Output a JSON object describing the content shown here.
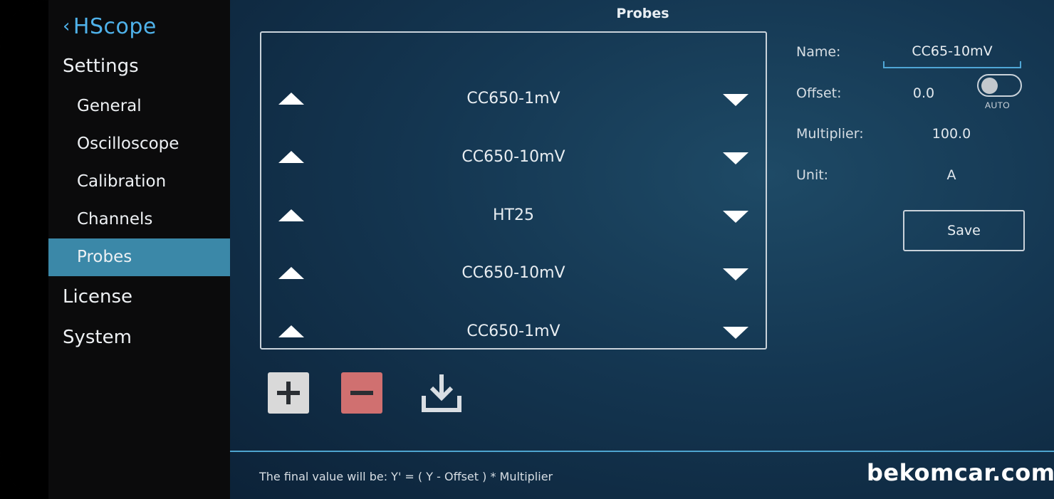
{
  "sidebar": {
    "back_chevron": "‹",
    "app_title": "HScope",
    "settings": "Settings",
    "items": [
      {
        "label": "General"
      },
      {
        "label": "Oscilloscope"
      },
      {
        "label": "Calibration"
      },
      {
        "label": "Channels"
      },
      {
        "label": "Probes"
      }
    ],
    "license": "License",
    "system": "System",
    "active_item": "Probes"
  },
  "main": {
    "title": "Probes",
    "probes": [
      {
        "label": "CC650-1mV"
      },
      {
        "label": "CC650-10mV"
      },
      {
        "label": "HT25"
      },
      {
        "label": "CC650-10mV"
      },
      {
        "label": "CC650-1mV"
      }
    ],
    "actions": {
      "add_icon": "plus-icon",
      "remove_icon": "minus-icon",
      "download_icon": "download-icon"
    },
    "properties": {
      "name_label": "Name:",
      "name_value": "CC65-10mV",
      "offset_label": "Offset:",
      "offset_value": "0.0",
      "auto_label": "AUTO",
      "auto_enabled": false,
      "multiplier_label": "Multiplier:",
      "multiplier_value": "100.0",
      "unit_label": "Unit:",
      "unit_value": "A",
      "save_label": "Save"
    },
    "footer_note": "The final value will be: Y' = ( Y - Offset ) * Multiplier"
  },
  "watermark": "bekomcar.com",
  "colors": {
    "accent": "#4fb2ea",
    "active_item_bg": "#3b88a8",
    "remove_button": "#d07070",
    "add_button": "#d9d9d9"
  }
}
